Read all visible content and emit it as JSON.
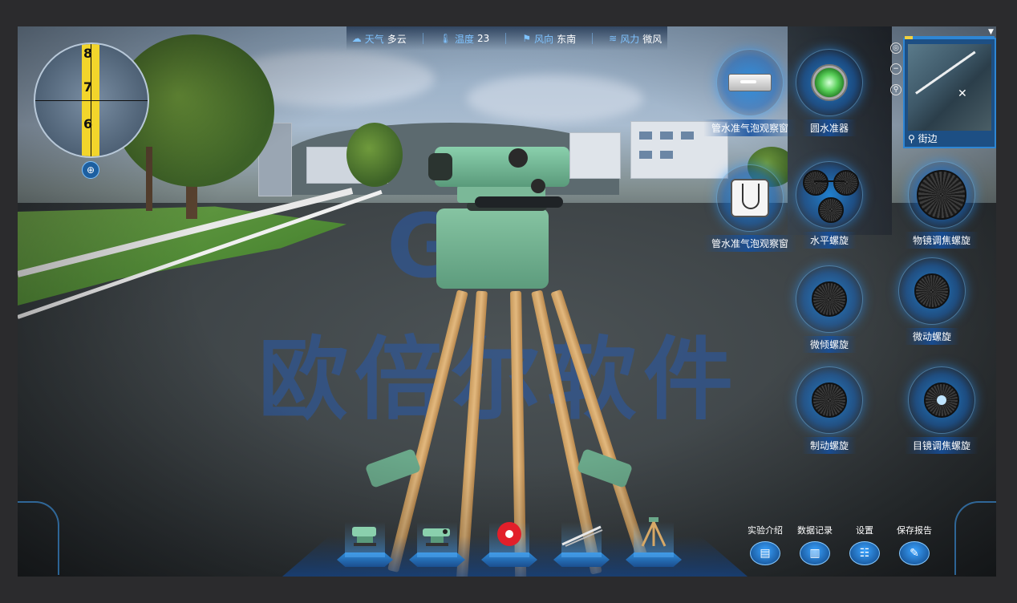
{
  "weather": {
    "weather_label": "天气",
    "weather_value": "多云",
    "temp_label": "温度",
    "temp_value": "23",
    "wind_dir_label": "风向",
    "wind_dir_value": "东南",
    "wind_force_label": "风力",
    "wind_force_value": "微风"
  },
  "scope": {
    "readings": [
      "8",
      "7",
      "6"
    ],
    "zoom_icon": "zoom-in-icon"
  },
  "watermark": {
    "logo": "GR",
    "text": "欧倍尔软件"
  },
  "controls": {
    "tube_bubble_window_1": "管水准气泡观察窗",
    "circular_bubble": "圆水准器",
    "tube_bubble_window_2": "管水准气泡观察窗",
    "leveling_screw": "水平螺旋",
    "objective_focus_screw": "物镜调焦螺旋",
    "tilting_screw": "微倾螺旋",
    "tangent_screw": "微动螺旋",
    "clamp_screw": "制动螺旋",
    "eyepiece_focus_screw": "目镜调焦螺旋"
  },
  "minimap": {
    "location": "街边"
  },
  "toolbar": {
    "tools": [
      "level-instrument",
      "level-instrument-alt",
      "tape-measure",
      "leveling-rod",
      "tripod"
    ]
  },
  "actions": {
    "intro": "实验介绍",
    "data_record": "数据记录",
    "settings": "设置",
    "save_report": "保存报告"
  },
  "colors": {
    "accent": "#2e86d4",
    "label_bg": "#1450a0",
    "staff": "#f2d52b"
  }
}
